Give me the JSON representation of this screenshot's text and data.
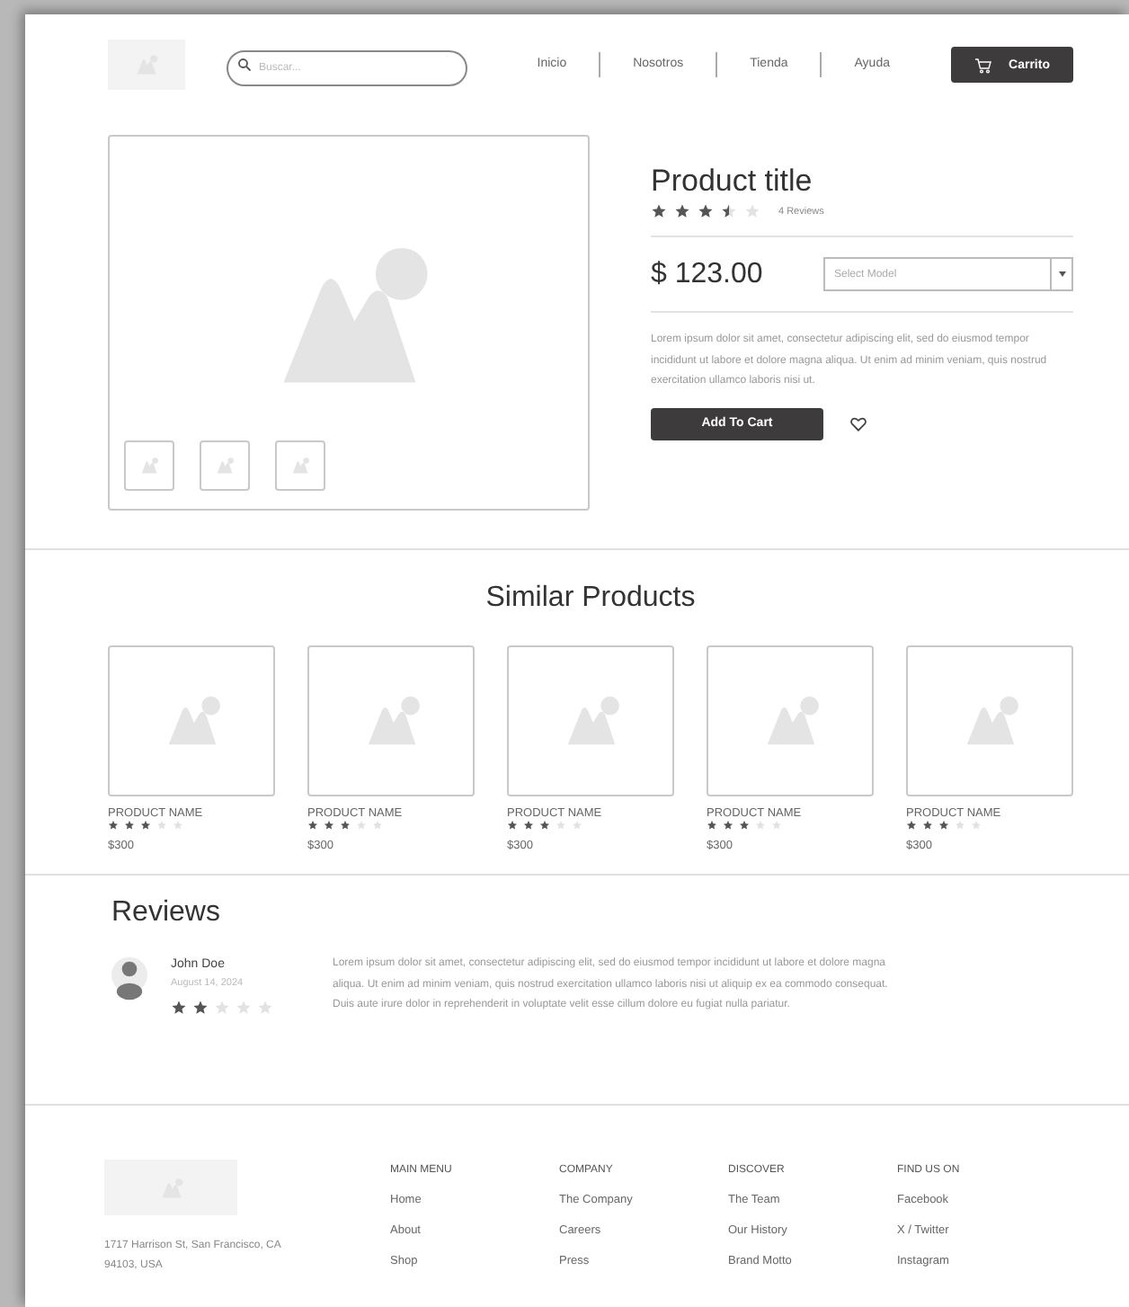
{
  "header": {
    "search": {
      "placeholder": "Buscar..."
    },
    "nav": [
      {
        "label": "Inicio"
      },
      {
        "label": "Nosotros"
      },
      {
        "label": "Tienda"
      },
      {
        "label": "Ayuda"
      }
    ],
    "cart_button": "Carrito"
  },
  "product": {
    "thumbnails": [
      {
        "kind": "image"
      },
      {
        "kind": "image"
      },
      {
        "kind": "image"
      }
    ],
    "title": "Product title",
    "stars": 3.5,
    "reviews": "4 Reviews",
    "price": "$ 123.00",
    "model_select": {
      "placeholder": "Select Model"
    },
    "description": "Lorem ipsum dolor sit amet, consectetur adipiscing elit, sed do eiusmod tempor incididunt ut labore et dolore magna aliqua. Ut enim ad minim veniam, quis nostrud exercitation ullamco laboris nisi ut.",
    "add_to_cart": "Add To Cart"
  },
  "similar_products": {
    "title": "Similar Products",
    "items": [
      {
        "name": "PRODUCT NAME",
        "stars": 3,
        "price": "$300"
      },
      {
        "name": "PRODUCT NAME",
        "stars": 3,
        "price": "$300"
      },
      {
        "name": "PRODUCT NAME",
        "stars": 3,
        "price": "$300"
      },
      {
        "name": "PRODUCT NAME",
        "stars": 3,
        "price": "$300"
      },
      {
        "name": "PRODUCT NAME",
        "stars": 3,
        "price": "$300"
      }
    ]
  },
  "reviews": {
    "title": "Reviews",
    "items": [
      {
        "author": "John Doe",
        "date": "August 14, 2024",
        "stars": 2,
        "text": "Lorem ipsum dolor sit amet, consectetur adipiscing elit, sed do eiusmod tempor incididunt ut labore et dolore magna aliqua. Ut enim ad minim veniam, quis nostrud exercitation ullamco laboris nisi ut aliquip ex ea commodo consequat. Duis aute irure dolor in reprehenderit in voluptate velit esse cillum dolore eu fugiat nulla pariatur."
      }
    ]
  },
  "footer": {
    "address": "1717 Harrison St, San Francisco, CA 94103, USA",
    "columns": [
      {
        "heading": "MAIN MENU",
        "links": [
          "Home",
          "About",
          "Shop"
        ]
      },
      {
        "heading": "COMPANY",
        "links": [
          "The Company",
          "Careers",
          "Press"
        ]
      },
      {
        "heading": "DISCOVER",
        "links": [
          "The Team",
          "Our History",
          "Brand Motto"
        ]
      },
      {
        "heading": "FIND US ON",
        "links": [
          "Facebook",
          "X / Twitter",
          "Instagram"
        ]
      }
    ]
  }
}
